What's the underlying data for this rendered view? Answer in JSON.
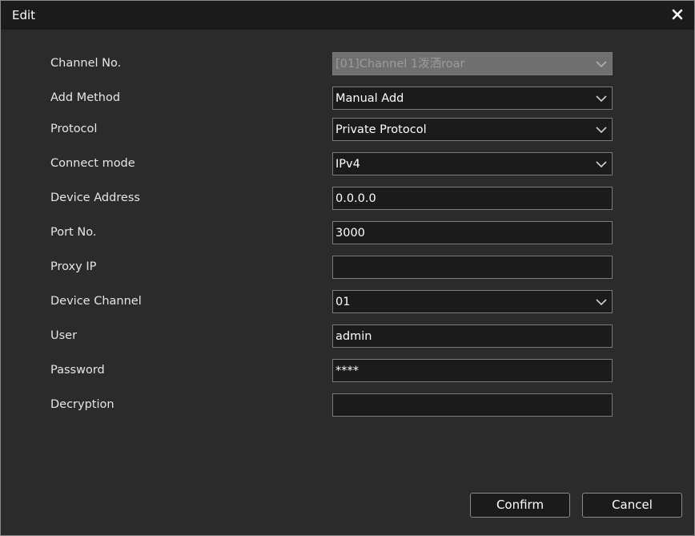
{
  "dialog": {
    "title": "Edit",
    "close_icon": "close-icon"
  },
  "form": {
    "channel_no": {
      "label": "Channel No.",
      "value": "[01]Channel 1泼洒roar",
      "disabled": true,
      "type": "dropdown"
    },
    "add_method": {
      "label": "Add Method",
      "value": "Manual Add",
      "type": "dropdown"
    },
    "protocol": {
      "label": "Protocol",
      "value": "Private Protocol",
      "type": "dropdown"
    },
    "connect_mode": {
      "label": "Connect mode",
      "value": "IPv4",
      "type": "dropdown"
    },
    "device_address": {
      "label": "Device Address",
      "value": "0.0.0.0",
      "type": "input"
    },
    "port_no": {
      "label": "Port No.",
      "value": "3000",
      "type": "input"
    },
    "proxy_ip": {
      "label": "Proxy IP",
      "value": "",
      "type": "input"
    },
    "device_channel": {
      "label": "Device Channel",
      "value": "01",
      "type": "dropdown"
    },
    "user": {
      "label": "User",
      "value": "admin",
      "type": "input"
    },
    "password": {
      "label": "Password",
      "value": "****",
      "type": "input"
    },
    "decryption": {
      "label": "Decryption",
      "value": "",
      "type": "input"
    }
  },
  "buttons": {
    "confirm_label": "Confirm",
    "cancel_label": "Cancel"
  },
  "colors": {
    "background": "#2b2b2b",
    "titlebar": "#1b1b1b",
    "field_bg": "#1b1b1b",
    "field_border": "#7a7a7a",
    "disabled_bg": "#707070",
    "text": "#ffffff"
  }
}
